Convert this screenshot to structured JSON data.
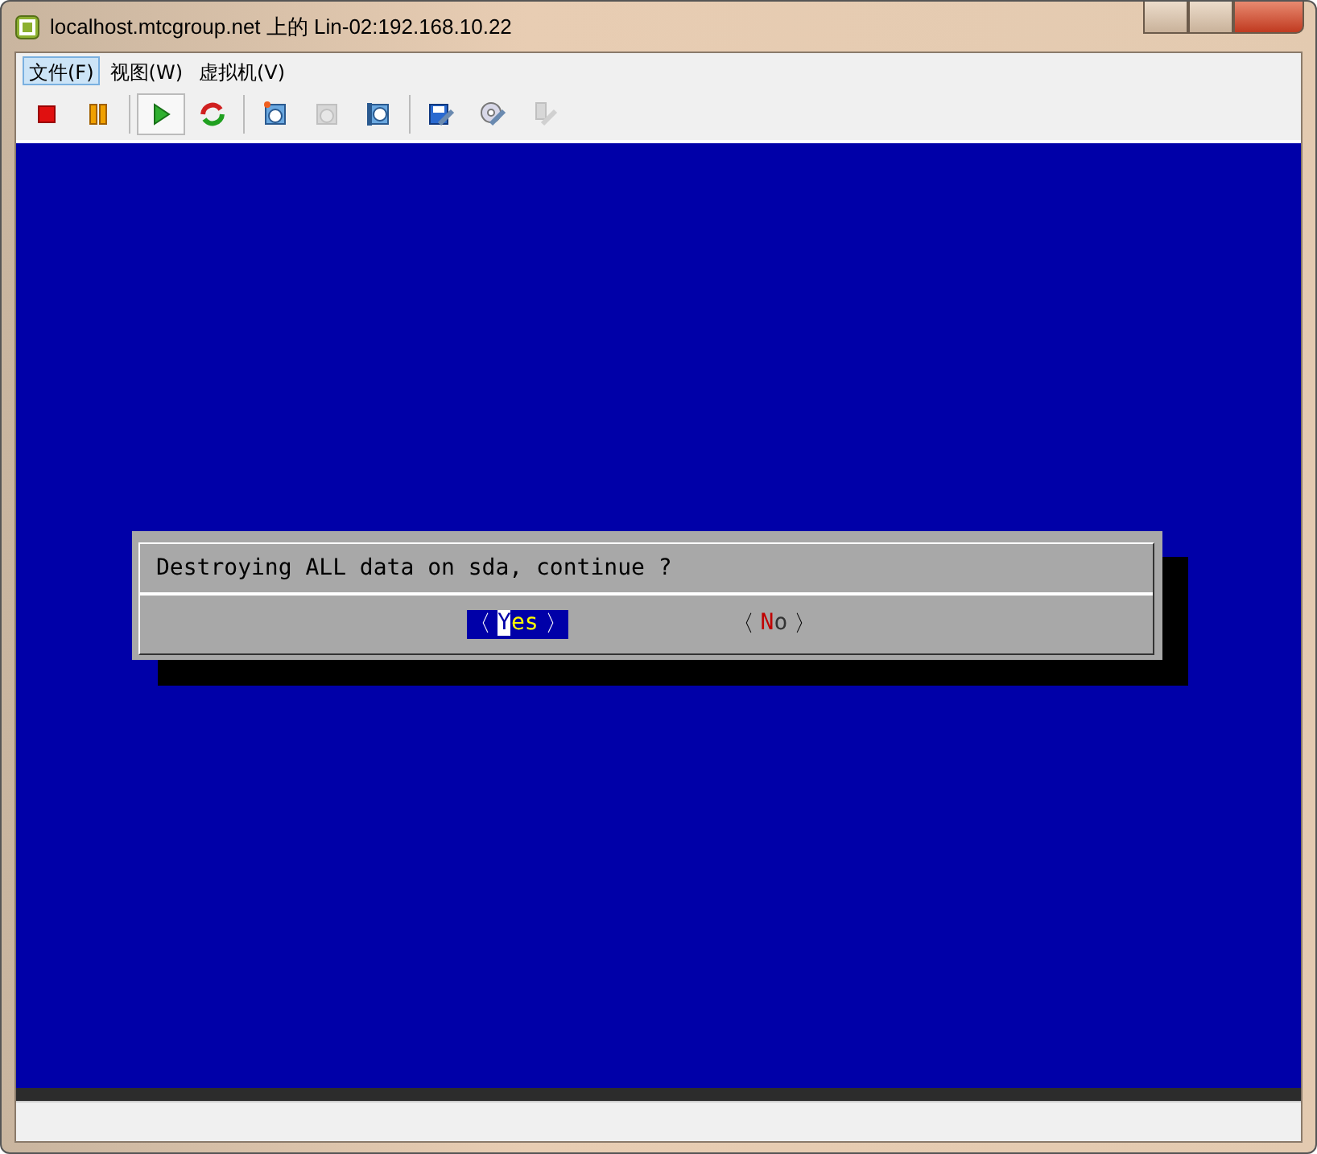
{
  "window": {
    "title": "localhost.mtcgroup.net 上的 Lin-02:192.168.10.22"
  },
  "menu": [
    {
      "label": "文件(F)",
      "selected": true
    },
    {
      "label": "视图(W)",
      "selected": false
    },
    {
      "label": "虚拟机(V)",
      "selected": false
    }
  ],
  "toolbar": [
    {
      "kind": "stop",
      "disabled": false,
      "pressed": false
    },
    {
      "kind": "pause",
      "disabled": false,
      "pressed": false
    },
    {
      "kind": "play",
      "disabled": false,
      "pressed": true
    },
    {
      "kind": "reset",
      "disabled": false,
      "pressed": false
    },
    {
      "kind": "snapshot",
      "disabled": false,
      "pressed": false
    },
    {
      "kind": "revert",
      "disabled": true,
      "pressed": false
    },
    {
      "kind": "snapmgr",
      "disabled": false,
      "pressed": false
    },
    {
      "kind": "settings",
      "disabled": false,
      "pressed": false
    },
    {
      "kind": "cd",
      "disabled": false,
      "pressed": false
    },
    {
      "kind": "usb",
      "disabled": true,
      "pressed": false
    }
  ],
  "dialog": {
    "message": "Destroying ALL data on sda, continue ?",
    "bracket_left": "〈",
    "bracket_right": "〉",
    "buttons": [
      {
        "label": "Yes",
        "selected": true
      },
      {
        "label": "No",
        "selected": false
      }
    ]
  }
}
